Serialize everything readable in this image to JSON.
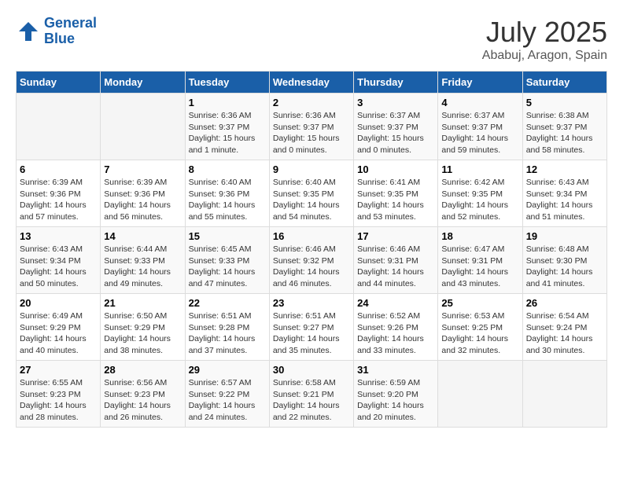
{
  "header": {
    "logo_line1": "General",
    "logo_line2": "Blue",
    "month": "July 2025",
    "location": "Ababuj, Aragon, Spain"
  },
  "weekdays": [
    "Sunday",
    "Monday",
    "Tuesday",
    "Wednesday",
    "Thursday",
    "Friday",
    "Saturday"
  ],
  "weeks": [
    [
      {
        "day": "",
        "info": ""
      },
      {
        "day": "",
        "info": ""
      },
      {
        "day": "1",
        "info": "Sunrise: 6:36 AM\nSunset: 9:37 PM\nDaylight: 15 hours and 1 minute."
      },
      {
        "day": "2",
        "info": "Sunrise: 6:36 AM\nSunset: 9:37 PM\nDaylight: 15 hours and 0 minutes."
      },
      {
        "day": "3",
        "info": "Sunrise: 6:37 AM\nSunset: 9:37 PM\nDaylight: 15 hours and 0 minutes."
      },
      {
        "day": "4",
        "info": "Sunrise: 6:37 AM\nSunset: 9:37 PM\nDaylight: 14 hours and 59 minutes."
      },
      {
        "day": "5",
        "info": "Sunrise: 6:38 AM\nSunset: 9:37 PM\nDaylight: 14 hours and 58 minutes."
      }
    ],
    [
      {
        "day": "6",
        "info": "Sunrise: 6:39 AM\nSunset: 9:36 PM\nDaylight: 14 hours and 57 minutes."
      },
      {
        "day": "7",
        "info": "Sunrise: 6:39 AM\nSunset: 9:36 PM\nDaylight: 14 hours and 56 minutes."
      },
      {
        "day": "8",
        "info": "Sunrise: 6:40 AM\nSunset: 9:36 PM\nDaylight: 14 hours and 55 minutes."
      },
      {
        "day": "9",
        "info": "Sunrise: 6:40 AM\nSunset: 9:35 PM\nDaylight: 14 hours and 54 minutes."
      },
      {
        "day": "10",
        "info": "Sunrise: 6:41 AM\nSunset: 9:35 PM\nDaylight: 14 hours and 53 minutes."
      },
      {
        "day": "11",
        "info": "Sunrise: 6:42 AM\nSunset: 9:35 PM\nDaylight: 14 hours and 52 minutes."
      },
      {
        "day": "12",
        "info": "Sunrise: 6:43 AM\nSunset: 9:34 PM\nDaylight: 14 hours and 51 minutes."
      }
    ],
    [
      {
        "day": "13",
        "info": "Sunrise: 6:43 AM\nSunset: 9:34 PM\nDaylight: 14 hours and 50 minutes."
      },
      {
        "day": "14",
        "info": "Sunrise: 6:44 AM\nSunset: 9:33 PM\nDaylight: 14 hours and 49 minutes."
      },
      {
        "day": "15",
        "info": "Sunrise: 6:45 AM\nSunset: 9:33 PM\nDaylight: 14 hours and 47 minutes."
      },
      {
        "day": "16",
        "info": "Sunrise: 6:46 AM\nSunset: 9:32 PM\nDaylight: 14 hours and 46 minutes."
      },
      {
        "day": "17",
        "info": "Sunrise: 6:46 AM\nSunset: 9:31 PM\nDaylight: 14 hours and 44 minutes."
      },
      {
        "day": "18",
        "info": "Sunrise: 6:47 AM\nSunset: 9:31 PM\nDaylight: 14 hours and 43 minutes."
      },
      {
        "day": "19",
        "info": "Sunrise: 6:48 AM\nSunset: 9:30 PM\nDaylight: 14 hours and 41 minutes."
      }
    ],
    [
      {
        "day": "20",
        "info": "Sunrise: 6:49 AM\nSunset: 9:29 PM\nDaylight: 14 hours and 40 minutes."
      },
      {
        "day": "21",
        "info": "Sunrise: 6:50 AM\nSunset: 9:29 PM\nDaylight: 14 hours and 38 minutes."
      },
      {
        "day": "22",
        "info": "Sunrise: 6:51 AM\nSunset: 9:28 PM\nDaylight: 14 hours and 37 minutes."
      },
      {
        "day": "23",
        "info": "Sunrise: 6:51 AM\nSunset: 9:27 PM\nDaylight: 14 hours and 35 minutes."
      },
      {
        "day": "24",
        "info": "Sunrise: 6:52 AM\nSunset: 9:26 PM\nDaylight: 14 hours and 33 minutes."
      },
      {
        "day": "25",
        "info": "Sunrise: 6:53 AM\nSunset: 9:25 PM\nDaylight: 14 hours and 32 minutes."
      },
      {
        "day": "26",
        "info": "Sunrise: 6:54 AM\nSunset: 9:24 PM\nDaylight: 14 hours and 30 minutes."
      }
    ],
    [
      {
        "day": "27",
        "info": "Sunrise: 6:55 AM\nSunset: 9:23 PM\nDaylight: 14 hours and 28 minutes."
      },
      {
        "day": "28",
        "info": "Sunrise: 6:56 AM\nSunset: 9:23 PM\nDaylight: 14 hours and 26 minutes."
      },
      {
        "day": "29",
        "info": "Sunrise: 6:57 AM\nSunset: 9:22 PM\nDaylight: 14 hours and 24 minutes."
      },
      {
        "day": "30",
        "info": "Sunrise: 6:58 AM\nSunset: 9:21 PM\nDaylight: 14 hours and 22 minutes."
      },
      {
        "day": "31",
        "info": "Sunrise: 6:59 AM\nSunset: 9:20 PM\nDaylight: 14 hours and 20 minutes."
      },
      {
        "day": "",
        "info": ""
      },
      {
        "day": "",
        "info": ""
      }
    ]
  ]
}
